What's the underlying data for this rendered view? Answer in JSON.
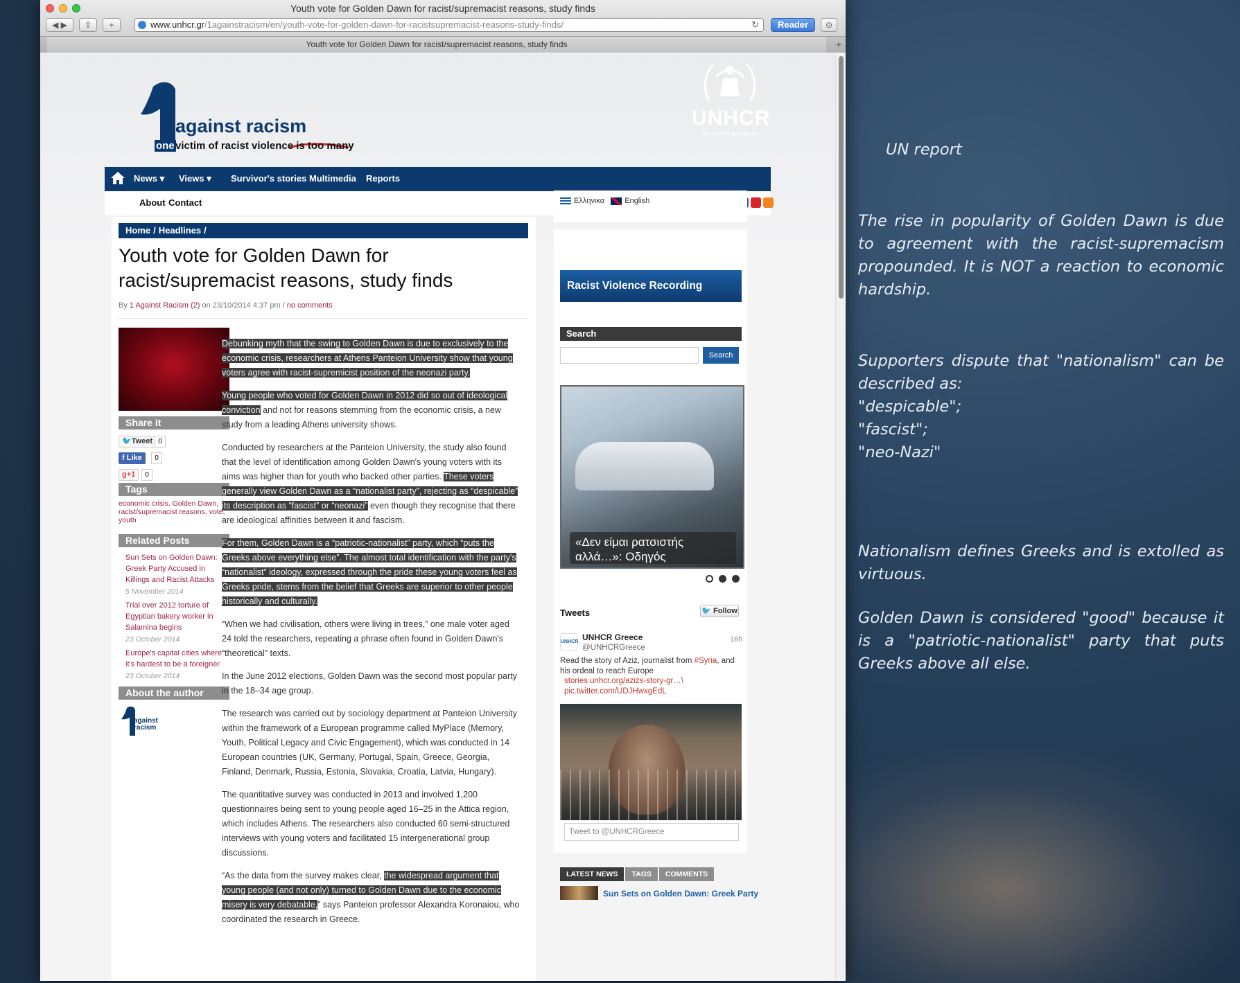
{
  "window": {
    "title": "Youth vote for Golden Dawn for racist/supremacist reasons, study finds",
    "url_host": "www.unhcr.gr",
    "url_path": "/1againstracism/en/youth-vote-for-golden-dawn-for-racistsupremacist-reasons-study-finds/",
    "reader_label": "Reader",
    "tab_title": "Youth vote for Golden Dawn for racist/supremacist reasons, study finds"
  },
  "site": {
    "logo_main": "against racism",
    "logo_one": "one",
    "logo_tag": "victim of racist violence",
    "logo_tag_underline": "is too many",
    "unhcr_name": "UNHCR",
    "unhcr_sub": "The UN Refugee Agency"
  },
  "nav": {
    "items": [
      "News",
      "Views",
      "Survivor's stories",
      "Multimedia",
      "Reports"
    ],
    "sub": [
      "About",
      "Contact"
    ]
  },
  "article": {
    "breadcrumb": [
      "Home",
      "/",
      "Headlines",
      "/"
    ],
    "title": "Youth vote for Golden Dawn for racist/supremacist reasons, study finds",
    "by": "By",
    "author": "1 Against Racism (2)",
    "on": "on 23/10/2014 4:37 pm /",
    "comments": "no comments",
    "p1": "Debunking myth that the swing to Golden Dawn is due to exclusively to the economic crisis, researchers at Athens Panteion University show that young voters agree with racist-supremicist position of the neonazi party.",
    "p2_hl": "Young people who voted for Golden Dawn in 2012 did so out of ideological conviction",
    "p2_rest": " and not for reasons stemming from the economic crisis, a new study from a leading Athens university shows.",
    "p3_a": "Conducted by researchers at the Panteion University, the study also found that the level of identification among Golden Dawn's young voters with its aims was higher than for youth who backed other parties. ",
    "p3_hl": "These voters generally view Golden Dawn as a “nationalist party”, rejecting as “despicable” its description as “fascist” or “neonazi”",
    "p3_b": " even though they recognise that there are ideological affinities between it and fascism.",
    "p4": "For them, Golden Dawn is a “patriotic-nationalist” party, which “puts the Greeks above everything else”. The almost total identification with the party's “nationalist” ideology, expressed through the pride these young voters feel as Greeks pride, stems from the belief that Greeks are superior to other people historically and culturally.",
    "p5": "“When we had civilisation, others were living in trees,” one male voter aged 24 told the researchers, repeating a phrase often found in Golden Dawn's “theoretical” texts.",
    "p6": "In the June 2012 elections, Golden Dawn was the second most popular party in the 18–34 age group.",
    "p7": "The research was carried out by sociology department at Panteion University within the framework of a European programme called MyPlace (Memory, Youth, Political Legacy and Civic Engagement), which was conducted in 14 European countries (UK, Germany, Portugal, Spain, Greece, Georgia, Finland, Denmark, Russia, Estonia, Slovakia, Croatia, Latvia, Hungary).",
    "p8": "The quantitative survey was conducted in 2013 and involved 1,200 questionnaires being sent to young people aged 16–25 in the Attica region, which includes Athens. The researchers also conducted 60 semi-structured interviews with young voters and facilitated 15 intergenerational group discussions.",
    "p9_a": "“As the data from the survey makes clear, ",
    "p9_hl": "the widespread argument that young people (and not only) turned to Golden Dawn due to the economic misery is very debatable,",
    "p9_b": "” says Panteion professor Alexandra Koronaiou, who coordinated the research in Greece."
  },
  "left": {
    "share_head": "Share it",
    "tweet": "Tweet",
    "tweet_count": "0",
    "like": "Like",
    "like_count": "0",
    "gplus": "g+1",
    "gplus_count": "0",
    "tags_head": "Tags",
    "tags": "economic crisis, Golden Dawn, racist/supremacist reasons, vote, youth",
    "related_head": "Related Posts",
    "related": [
      {
        "title": "Sun Sets on Golden Dawn: Greek Party Accused in Killings and Racist Attacks",
        "date": "5 November 2014"
      },
      {
        "title": "Trial over 2012 torture of Egyptian bakery worker in Salamina begins",
        "date": "23 October 2014"
      },
      {
        "title": "Europe's capital cities where it's hardest to be a foreigner",
        "date": "23 October 2014"
      }
    ],
    "author_head": "About the author",
    "author_logo_a": "against",
    "author_logo_b": "racism"
  },
  "right": {
    "lang_el": "Ελληνικα",
    "lang_en": "English",
    "rvrn": "Racist Violence Recording Network",
    "search_head": "Search",
    "search_btn": "Search",
    "slider_caption": "«Δεν είμαι ρατσιστής αλλά…»: Οδηγός",
    "tweets_head": "Tweets",
    "follow": "Follow",
    "tw_name": "UNHCR Greece",
    "tw_handle": "@UNHCRGreece",
    "tw_time": "16h",
    "tw_text_a": "Read the story of Aziz, journalist from ",
    "tw_hash": "#Syria",
    "tw_text_b": ", and his ordeal to reach Europe",
    "tw_link1": "stories.unhcr.org/azizs-story-gr…\\",
    "tw_link2": "pic.twitter.com/UDJHwxgEdL",
    "tw_input": "Tweet to @UNHCRGreece",
    "tabs": [
      "LATEST NEWS",
      "TAGS",
      "COMMENTS"
    ],
    "latest": "Sun Sets on Golden Dawn: Greek Party"
  },
  "notes": {
    "title": "UN report",
    "n1": "The rise in popularity of Golden Dawn is due to agreement with the racist-supremacism propounded. It is NOT a reaction to economic hardship.",
    "n2a": "Supporters dispute that \"nationalism\" can be described as:",
    "n2b": "\"despicable\";",
    "n2c": "\"fascist\";",
    "n2d": "\"neo-Nazi\"",
    "n3": "Nationalism defines Greeks and is extolled as virtuous.",
    "n4": "Golden Dawn is considered \"good\" because it is a \"patriotic-nationalist\" party that puts Greeks above all else."
  }
}
